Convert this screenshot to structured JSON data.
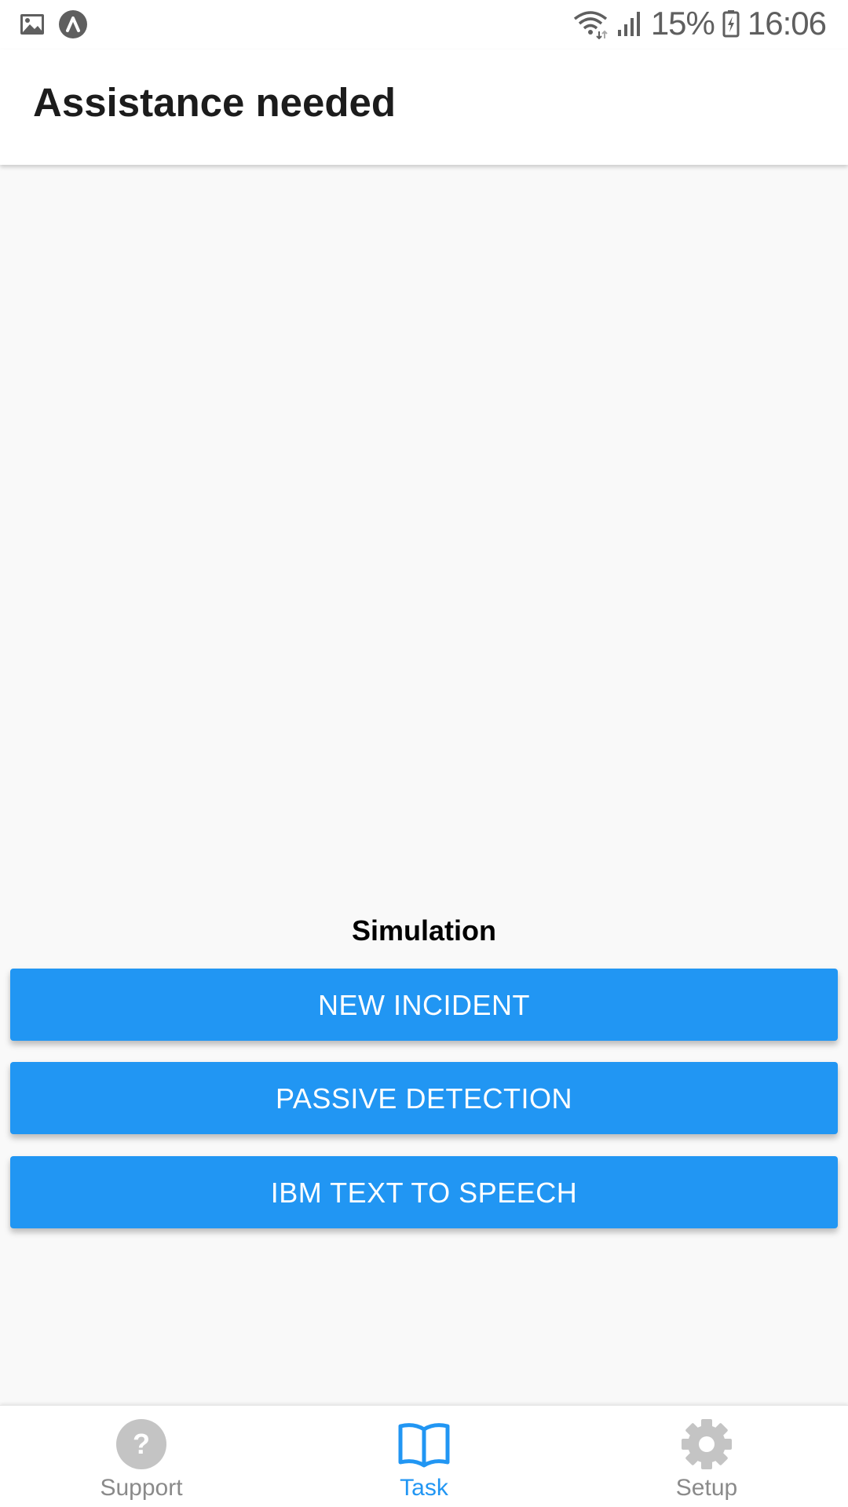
{
  "status_bar": {
    "battery_percent": "15%",
    "time": "16:06",
    "icons": [
      "gallery-icon",
      "app-logo-icon",
      "wifi-icon",
      "signal-icon",
      "battery-icon"
    ]
  },
  "app_bar": {
    "title": "Assistance needed"
  },
  "simulation": {
    "heading": "Simulation",
    "buttons": [
      {
        "label": "NEW INCIDENT"
      },
      {
        "label": "PASSIVE DETECTION"
      },
      {
        "label": "IBM TEXT TO SPEECH"
      }
    ]
  },
  "bottom_nav": {
    "items": [
      {
        "label": "Support",
        "icon": "help-circle-icon",
        "active": false
      },
      {
        "label": "Task",
        "icon": "book-icon",
        "active": true
      },
      {
        "label": "Setup",
        "icon": "gear-icon",
        "active": false
      }
    ]
  },
  "colors": {
    "accent": "#2196f3",
    "inactive": "#b8b8b8",
    "background": "#f9f9f9"
  }
}
